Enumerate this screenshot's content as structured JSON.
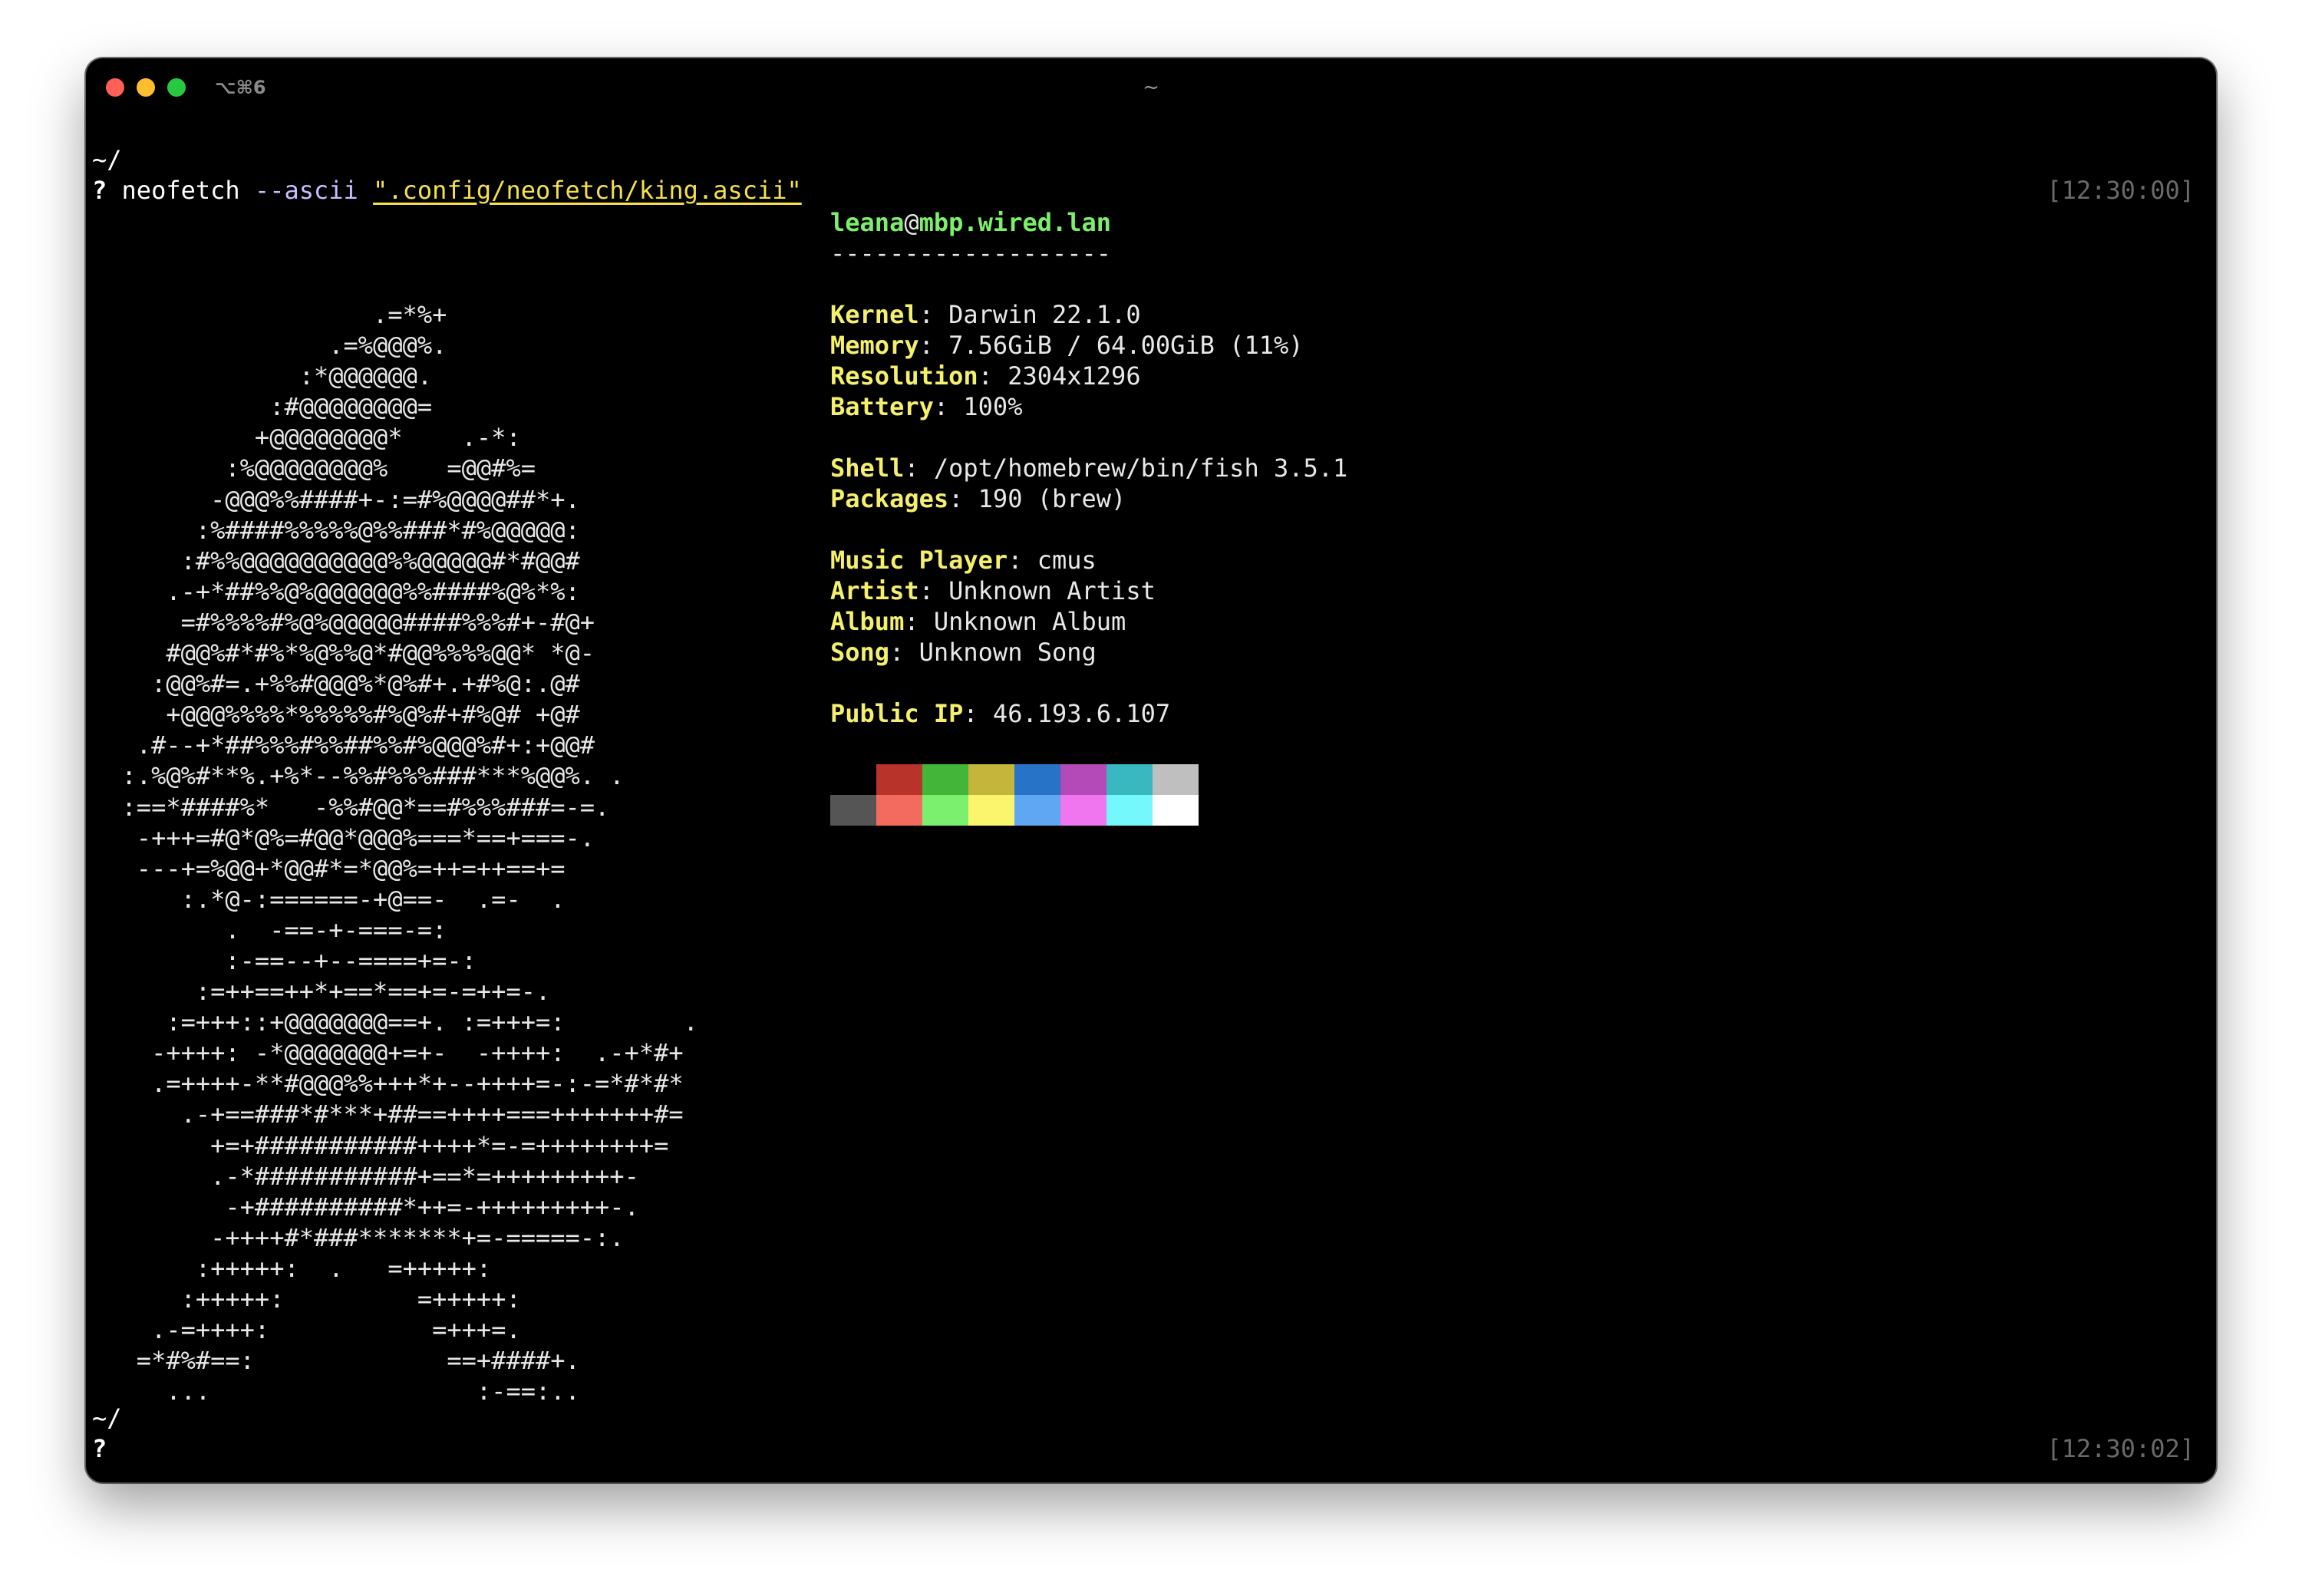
{
  "window": {
    "shortcut": "⌥⌘6",
    "title": "~",
    "traffic_lights": {
      "close": "#ff5f57",
      "minimize": "#febc2e",
      "maximize": "#28c840"
    }
  },
  "session1": {
    "cwd": "~/",
    "prompt": "?",
    "command": "neofetch",
    "flag": "--ascii",
    "arg": "\".config/neofetch/king.ascii\"",
    "timestamp": "[12:30:00]"
  },
  "ascii_art": "                   .=*%+\n                .=%@@@%.\n              :*@@@@@@.\n            :#@@@@@@@@=\n           +@@@@@@@@*    .-*:\n         :%@@@@@@@@%    =@@#%=\n        -@@@%%####+-:=#%@@@@##*+.\n       :%####%%%%%@%%###*#%@@@@@:\n      :#%%@@@@@@@@@@%%@@@@@#*#@@#\n     .-+*##%%@%@@@@@@%%####%@%*%:\n      =#%%%%#%@%@@@@@####%%%#+-#@+\n     #@@%#*#%*%@%%@*#@@%%%%@@* *@-\n    :@@%#=.+%%#@@@%*@%#+.+#%@:.@#\n     +@@@%%%%*%%%%%#%@%#+#%@# +@#\n   .#--+*##%%%#%%##%%#%@@@%#+:+@@#\n  :.%@%#**%.+%*--%%#%%%###***%@@%. .\n  :==*####%*   -%%#@@*==#%%%###=-=.\n   -+++=#@*@%=#@@*@@@%===*==+===-.\n   ---+=%@@+*@@#*=*@@%=++=++==+=\n      :.*@-:======-+@==-  .=-  .\n         .  -==-+-===-=:\n         :-==--+--====+=-:\n       :=++==++*+==*==+=-=++=-.\n     :=+++::+@@@@@@@==+. :=+++=:        .\n    -++++: -*@@@@@@@+=+-  -++++:  .-+*#+\n    .=++++-**#@@@%%+++*+--++++=-:-=*#*#*\n      .-+==###*#***+##==++++===+++++++#=\n        +=+###########++++*=-=++++++++=\n        .-*###########+==*=+++++++++-\n         -+##########*++=-+++++++++-.\n        -++++#*###*******+=-=====-:.\n       :+++++:  .   =+++++:\n      :+++++:         =+++++:\n    .-=++++:           =+++=.\n   =*#%#==:             ==+####+.\n     ...                  :-==:..",
  "info": {
    "user": "leana",
    "at": "@",
    "host": "mbp.wired.lan",
    "separator": "-------------------",
    "kernel": {
      "key": "Kernel",
      "value": ": Darwin 22.1.0"
    },
    "memory": {
      "key": "Memory",
      "value": ": 7.56GiB / 64.00GiB (11%)"
    },
    "resolution": {
      "key": "Resolution",
      "value": ": 2304x1296"
    },
    "battery": {
      "key": "Battery",
      "value": ": 100%"
    },
    "shell": {
      "key": "Shell",
      "value": ": /opt/homebrew/bin/fish 3.5.1"
    },
    "packages": {
      "key": "Packages",
      "value": ": 190 (brew)"
    },
    "music_player": {
      "key": "Music Player",
      "value": ": cmus"
    },
    "artist": {
      "key": "Artist",
      "value": ": Unknown Artist"
    },
    "album": {
      "key": "Album",
      "value": ": Unknown Album"
    },
    "song": {
      "key": "Song",
      "value": ": Unknown Song"
    },
    "public_ip": {
      "key": "Public IP",
      "value": ": 46.193.6.107"
    }
  },
  "palette": {
    "normal": [
      "#000000",
      "#b8342a",
      "#43b63a",
      "#c4b53b",
      "#2773c7",
      "#b34ab7",
      "#3ab8c2",
      "#bfbfbf"
    ],
    "bright": [
      "#555555",
      "#f36b5f",
      "#7bf06f",
      "#fbf56e",
      "#5fa7f2",
      "#ef76ef",
      "#74f8fc",
      "#ffffff"
    ]
  },
  "session2": {
    "cwd": "~/",
    "prompt": "?",
    "timestamp": "[12:30:02]"
  }
}
